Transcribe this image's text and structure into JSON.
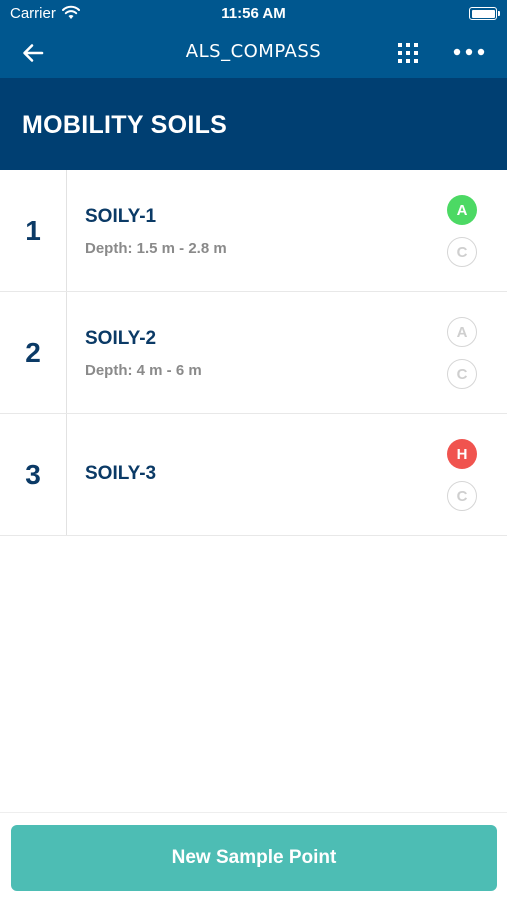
{
  "status_bar": {
    "carrier": "Carrier",
    "time": "11:56 AM",
    "icons": [
      "wifi-icon",
      "battery-icon"
    ]
  },
  "nav": {
    "title": "ALS_COMPASS",
    "icons": [
      "back-arrow-icon",
      "grid-icon",
      "more-dots-icon"
    ]
  },
  "header": {
    "title": "MOBILITY SOILS"
  },
  "samples": [
    {
      "number": "1",
      "name": "SOILY-1",
      "depth": "Depth: 1.5 m - 2.8 m",
      "badges": [
        {
          "letter": "A",
          "style": "filled",
          "color": "#4cd964"
        },
        {
          "letter": "C",
          "style": "outline"
        }
      ]
    },
    {
      "number": "2",
      "name": "SOILY-2",
      "depth": "Depth: 4 m - 6 m",
      "badges": [
        {
          "letter": "A",
          "style": "outline"
        },
        {
          "letter": "C",
          "style": "outline"
        }
      ]
    },
    {
      "number": "3",
      "name": "SOILY-3",
      "depth": "",
      "badges": [
        {
          "letter": "H",
          "style": "filled",
          "color": "#f0544f"
        },
        {
          "letter": "C",
          "style": "outline"
        }
      ]
    }
  ],
  "footer": {
    "button_label": "New Sample Point"
  },
  "colors": {
    "nav_bg": "#00578f",
    "header_bg": "#003f72",
    "accent": "#4dbdb4",
    "title_text": "#0b3a66",
    "muted_text": "#8a8a8a"
  }
}
